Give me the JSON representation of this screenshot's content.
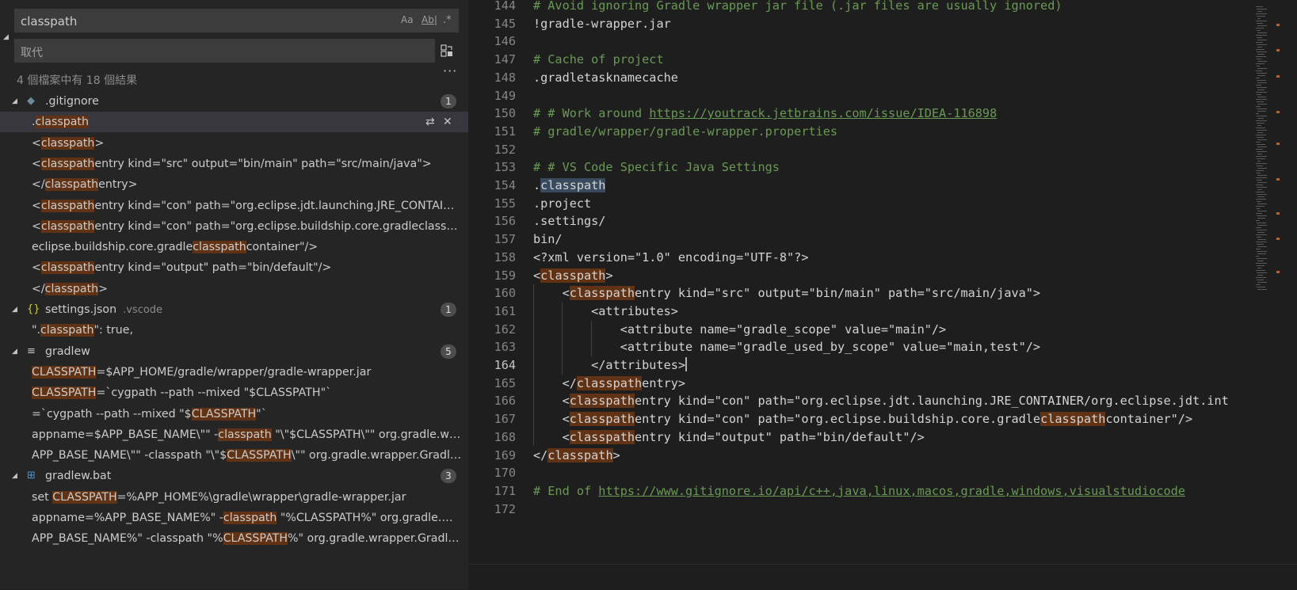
{
  "search": {
    "query": "classpath",
    "replace_placeholder": "取代",
    "match_case_label": "Aa",
    "whole_word_label": "Ab|",
    "regex_label": ".*",
    "summary": "4 個檔案中有 18 個結果"
  },
  "results": [
    {
      "file": ".gitignore",
      "dir": "",
      "icon": "git-icon",
      "count": "1",
      "matches": [
        {
          "pre": ".",
          "m": "classpath",
          "post": ""
        }
      ]
    },
    {
      "file": "",
      "dir": "",
      "icon": "",
      "count": "",
      "matches": [
        {
          "pre": "<",
          "m": "classpath",
          "post": ">"
        },
        {
          "pre": "<",
          "m": "classpath",
          "post": "entry kind=\"src\" output=\"bin/main\" path=\"src/main/java\">"
        },
        {
          "pre": "</",
          "m": "classpath",
          "post": "entry>"
        },
        {
          "pre": "<",
          "m": "classpath",
          "post": "entry kind=\"con\" path=\"org.eclipse.jdt.launching.JRE_CONTAINER/org.eclipse.jdt.internal"
        },
        {
          "pre": "<",
          "m": "classpath",
          "post": "entry kind=\"con\" path=\"org.eclipse.buildship.core.gradleclasspathcontainer\"/>"
        },
        {
          "pre": "eclipse.buildship.core.gradle",
          "m": "classpath",
          "post": "container\"/>"
        },
        {
          "pre": "<",
          "m": "classpath",
          "post": "entry kind=\"output\" path=\"bin/default\"/>"
        },
        {
          "pre": "</",
          "m": "classpath",
          "post": ">"
        }
      ]
    },
    {
      "file": "settings.json",
      "dir": ".vscode",
      "icon": "json-icon",
      "count": "1",
      "matches": [
        {
          "pre": "\".",
          "m": "classpath",
          "post": "\": true,"
        }
      ]
    },
    {
      "file": "gradlew",
      "dir": "",
      "icon": "lines-icon",
      "count": "5",
      "matches": [
        {
          "pre": "",
          "m": "CLASSPATH",
          "post": "=$APP_HOME/gradle/wrapper/gradle-wrapper.jar"
        },
        {
          "pre": "",
          "m": "CLASSPATH",
          "post": "=`cygpath --path --mixed \"$CLASSPATH\"`"
        },
        {
          "pre": "=`cygpath --path --mixed \"$",
          "m": "CLASSPATH",
          "post": "\"`"
        },
        {
          "pre": "appname=$APP_BASE_NAME\\\"\" -",
          "m": "classpath",
          "post": " \"\\\"$CLASSPATH\\\"\" org.gradle.wrapper.GradleWrapperMain"
        },
        {
          "pre": "APP_BASE_NAME\\\"\" -classpath \"\\\"$",
          "m": "CLASSPATH",
          "post": "\\\"\" org.gradle.wrapper.GradleWrapperMain"
        }
      ]
    },
    {
      "file": "gradlew.bat",
      "dir": "",
      "icon": "windows-icon",
      "count": "3",
      "matches": [
        {
          "pre": "set ",
          "m": "CLASSPATH",
          "post": "=%APP_HOME%\\gradle\\wrapper\\gradle-wrapper.jar"
        },
        {
          "pre": "appname=%APP_BASE_NAME%\" -",
          "m": "classpath",
          "post": " \"%CLASSPATH%\" org.gradle.wrapper.GradleWrapperMain"
        },
        {
          "pre": "APP_BASE_NAME%\" -classpath \"%",
          "m": "CLASSPATH",
          "post": "%\" org.gradle.wrapper.GradleWrapperMain"
        }
      ]
    }
  ],
  "editor": {
    "current_line": 164,
    "lines": [
      {
        "n": 144,
        "segs": [
          {
            "t": "# Avoid ignoring Gradle wrapper jar file (.jar files are usually ignored)",
            "c": "cmt"
          }
        ]
      },
      {
        "n": 145,
        "segs": [
          {
            "t": "!gradle-wrapper.jar"
          }
        ]
      },
      {
        "n": 146,
        "segs": []
      },
      {
        "n": 147,
        "segs": [
          {
            "t": "# Cache of project",
            "c": "cmt"
          }
        ]
      },
      {
        "n": 148,
        "segs": [
          {
            "t": ".gradletasknamecache"
          }
        ]
      },
      {
        "n": 149,
        "segs": []
      },
      {
        "n": 150,
        "segs": [
          {
            "t": "# # Work around ",
            "c": "cmt"
          },
          {
            "t": "https://youtrack.jetbrains.com/issue/IDEA-116898",
            "c": "lnk"
          }
        ]
      },
      {
        "n": 151,
        "segs": [
          {
            "t": "# gradle/wrapper/gradle-wrapper.properties",
            "c": "cmt"
          }
        ]
      },
      {
        "n": 152,
        "segs": []
      },
      {
        "n": 153,
        "segs": [
          {
            "t": "# # VS Code Specific Java Settings",
            "c": "cmt"
          }
        ]
      },
      {
        "n": 154,
        "segs": [
          {
            "t": "."
          },
          {
            "t": "classpath",
            "c": "hl2"
          }
        ]
      },
      {
        "n": 155,
        "segs": [
          {
            "t": ".project"
          }
        ]
      },
      {
        "n": 156,
        "segs": [
          {
            "t": ".settings/"
          }
        ]
      },
      {
        "n": 157,
        "segs": [
          {
            "t": "bin/"
          }
        ]
      },
      {
        "n": 158,
        "segs": [
          {
            "t": "<?xml version=\"1.0\" encoding=\"UTF-8\"?>"
          }
        ]
      },
      {
        "n": 159,
        "segs": [
          {
            "t": "<"
          },
          {
            "t": "classpath",
            "c": "hl"
          },
          {
            "t": ">"
          }
        ]
      },
      {
        "n": 160,
        "segs": [
          {
            "t": "    <"
          },
          {
            "t": "classpath",
            "c": "hl"
          },
          {
            "t": "entry kind=\"src\" output=\"bin/main\" path=\"src/main/java\">"
          }
        ]
      },
      {
        "n": 161,
        "segs": [
          {
            "t": "        <attributes>"
          }
        ]
      },
      {
        "n": 162,
        "segs": [
          {
            "t": "            <attribute name=\"gradle_scope\" value=\"main\"/>"
          }
        ]
      },
      {
        "n": 163,
        "segs": [
          {
            "t": "            <attribute name=\"gradle_used_by_scope\" value=\"main,test\"/>"
          }
        ]
      },
      {
        "n": 164,
        "segs": [
          {
            "t": "        </attributes>"
          }
        ]
      },
      {
        "n": 165,
        "segs": [
          {
            "t": "    </"
          },
          {
            "t": "classpath",
            "c": "hl"
          },
          {
            "t": "entry>"
          }
        ]
      },
      {
        "n": 166,
        "segs": [
          {
            "t": "    <"
          },
          {
            "t": "classpath",
            "c": "hl"
          },
          {
            "t": "entry kind=\"con\" path=\"org.eclipse.jdt.launching.JRE_CONTAINER/org.eclipse.jdt.int"
          }
        ]
      },
      {
        "n": 167,
        "segs": [
          {
            "t": "    <"
          },
          {
            "t": "classpath",
            "c": "hl"
          },
          {
            "t": "entry kind=\"con\" path=\"org.eclipse.buildship.core.gradle"
          },
          {
            "t": "classpath",
            "c": "hl"
          },
          {
            "t": "container\"/>"
          }
        ]
      },
      {
        "n": 168,
        "segs": [
          {
            "t": "    <"
          },
          {
            "t": "classpath",
            "c": "hl"
          },
          {
            "t": "entry kind=\"output\" path=\"bin/default\"/>"
          }
        ]
      },
      {
        "n": 169,
        "segs": [
          {
            "t": "</"
          },
          {
            "t": "classpath",
            "c": "hl"
          },
          {
            "t": ">"
          }
        ]
      },
      {
        "n": 170,
        "segs": []
      },
      {
        "n": 171,
        "segs": [
          {
            "t": "# End of ",
            "c": "cmt"
          },
          {
            "t": "https://www.gitignore.io/api/c++,java,linux,macos,gradle,windows,visualstudiocode",
            "c": "lnk"
          }
        ]
      },
      {
        "n": 172,
        "segs": []
      }
    ]
  },
  "colors": {
    "match_highlight": "#613214",
    "selection_highlight": "#3a4a5e",
    "comment": "#6a9955",
    "sidebar_bg": "#252526",
    "editor_bg": "#1e1e1e"
  }
}
